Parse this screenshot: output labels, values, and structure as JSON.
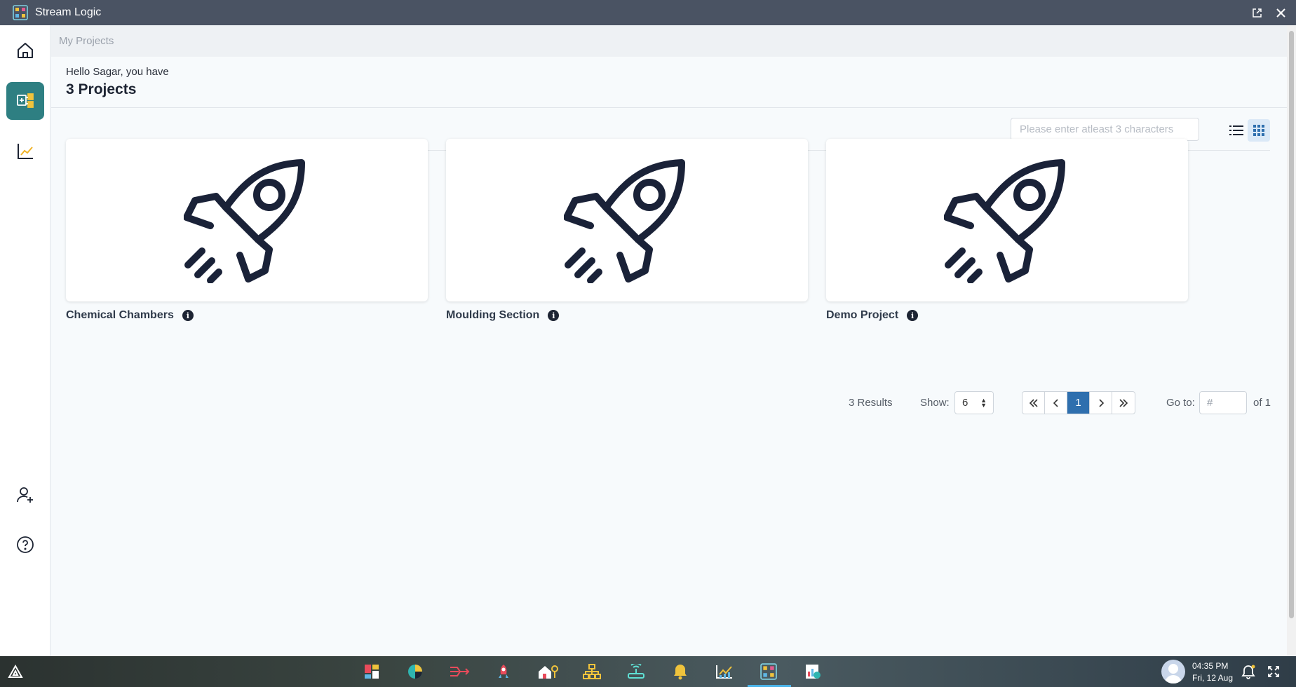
{
  "window": {
    "title": "Stream Logic"
  },
  "breadcrumb": "My Projects",
  "header": {
    "greeting": "Hello Sagar, you have",
    "project_count": "3 Projects"
  },
  "search": {
    "placeholder": "Please enter atleast 3 characters",
    "value": ""
  },
  "view_toggle": {
    "selected": "grid",
    "options": [
      "list",
      "grid"
    ]
  },
  "projects": [
    {
      "name": "Chemical Chambers",
      "icon": "rocket-icon"
    },
    {
      "name": "Moulding Section",
      "icon": "rocket-icon"
    },
    {
      "name": "Demo Project",
      "icon": "rocket-icon"
    }
  ],
  "pagination": {
    "results_text": "3 Results",
    "show_label": "Show:",
    "page_size": "6",
    "current_page": "1",
    "goto_label": "Go to:",
    "goto_placeholder": "#",
    "of_total": "of 1"
  },
  "sidebar": {
    "items": [
      {
        "name": "home",
        "icon": "home-icon"
      },
      {
        "name": "projects",
        "icon": "project-board-icon",
        "active": true
      },
      {
        "name": "analytics",
        "icon": "trend-chart-icon"
      },
      {
        "name": "add-user",
        "icon": "add-user-icon"
      },
      {
        "name": "help",
        "icon": "help-icon"
      }
    ]
  },
  "taskbar": {
    "time": "04:35 PM",
    "date": "Fri, 12 Aug"
  },
  "colors": {
    "accent": "#2e7f82",
    "rocket": "#1a2238",
    "pagination_active": "#2f6fae"
  }
}
